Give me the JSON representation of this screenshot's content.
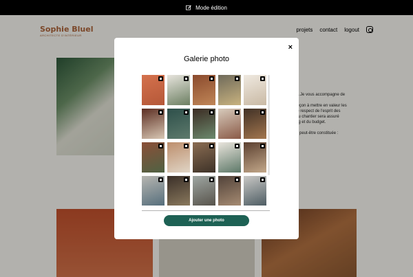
{
  "editbar": {
    "label": "Mode édition",
    "icon": "edit-icon"
  },
  "header": {
    "logo": "Sophie Bluel",
    "logo_sub": "Architecte d'intérieur",
    "nav": [
      "projets",
      "contact",
      "logout"
    ],
    "instagram_icon": "instagram-icon"
  },
  "about": {
    "text": [
      "…Je vous accompagne de",
      "",
      "jeçon à mettre en valeur les",
      "le respect de l'esprit des",
      "du chantier sera assuré",
      "ng et du budget.",
      "",
      "e peut-être constituée :"
    ]
  },
  "modal": {
    "title": "Galerie photo",
    "close": "×",
    "add_button": "Ajouter une photo"
  },
  "colors": {
    "accent": "#1d6154",
    "brand": "#b1663c",
    "editbar": "#000000"
  },
  "thumbnails": [
    {
      "c1": "#d4714d",
      "c2": "#b55838"
    },
    {
      "c1": "#e7e4dd",
      "c2": "#6c7f62"
    },
    {
      "c1": "#8a4a2d",
      "c2": "#c08657"
    },
    {
      "c1": "#6f6a5a",
      "c2": "#c8b27f"
    },
    {
      "c1": "#efe9e0",
      "c2": "#c9b9a4"
    },
    {
      "c1": "#5c2e22",
      "c2": "#d8c7b4"
    },
    {
      "c1": "#2d4f4a",
      "c2": "#5e7a6c"
    },
    {
      "c1": "#3b2b22",
      "c2": "#6c8a6e"
    },
    {
      "c1": "#d7cabb",
      "c2": "#8a5a47"
    },
    {
      "c1": "#413126",
      "c2": "#a2764e"
    },
    {
      "c1": "#8a4f38",
      "c2": "#4f6243"
    },
    {
      "c1": "#bd8e6c",
      "c2": "#e0d5c6"
    },
    {
      "c1": "#8a6c52",
      "c2": "#3d3228"
    },
    {
      "c1": "#e9e4dc",
      "c2": "#5d7868"
    },
    {
      "c1": "#5b4030",
      "c2": "#c3a88a"
    },
    {
      "c1": "#b7b6b1",
      "c2": "#546d7b"
    },
    {
      "c1": "#3a2f28",
      "c2": "#8b7a5e"
    },
    {
      "c1": "#9fa6a2",
      "c2": "#56524a"
    },
    {
      "c1": "#514239",
      "c2": "#a78c73"
    },
    {
      "c1": "#c9c8c5",
      "c2": "#4c5b62"
    }
  ]
}
